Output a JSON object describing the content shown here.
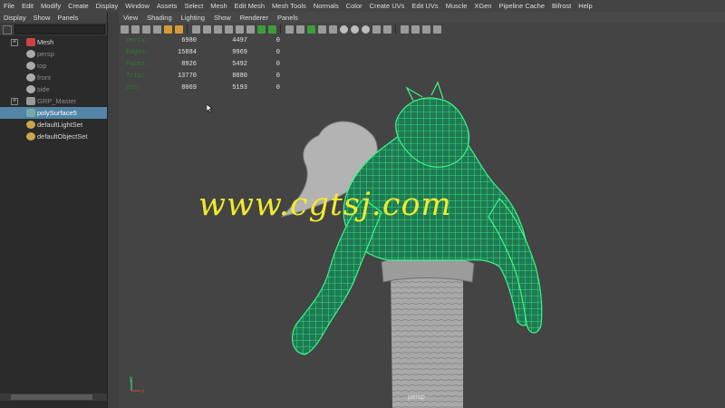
{
  "main_menu": [
    "File",
    "Edit",
    "Modify",
    "Create",
    "Display",
    "Window",
    "Assets",
    "Select",
    "Mesh",
    "Edit Mesh",
    "Mesh Tools",
    "Normals",
    "Color",
    "Create UVs",
    "Edit UVs",
    "Muscle",
    "XGen",
    "Pipeline Cache",
    "Bifrost",
    "Help"
  ],
  "outliner": {
    "menu": [
      "Display",
      "Show",
      "Panels"
    ],
    "items": [
      {
        "label": "Mesh",
        "icon": "mesh-icon",
        "expand": "+",
        "dim": false,
        "selected": false
      },
      {
        "label": "persp",
        "icon": "camera-icon",
        "dim": true,
        "selected": false
      },
      {
        "label": "top",
        "icon": "camera-icon",
        "dim": true,
        "selected": false
      },
      {
        "label": "front",
        "icon": "camera-icon",
        "dim": true,
        "selected": false
      },
      {
        "label": "side",
        "icon": "camera-icon",
        "dim": true,
        "selected": false
      },
      {
        "label": "GRP_Master",
        "icon": "group-icon",
        "expand": "+",
        "dim": true,
        "selected": false
      },
      {
        "label": "polySurface5",
        "icon": "poly-icon",
        "dim": false,
        "selected": true
      },
      {
        "label": "defaultLightSet",
        "icon": "set-icon",
        "dim": false,
        "selected": false
      },
      {
        "label": "defaultObjectSet",
        "icon": "set-icon",
        "dim": false,
        "selected": false
      }
    ]
  },
  "viewport": {
    "menu": [
      "View",
      "Shading",
      "Lighting",
      "Show",
      "Renderer",
      "Panels"
    ],
    "hud": [
      {
        "label": "Verts:",
        "v1": "6980",
        "v2": "4497",
        "v3": "0"
      },
      {
        "label": "Edges:",
        "v1": "15884",
        "v2": "9969",
        "v3": "0"
      },
      {
        "label": "Faces:",
        "v1": "8926",
        "v2": "5492",
        "v3": "0"
      },
      {
        "label": "Tris:",
        "v1": "13770",
        "v2": "8880",
        "v3": "0"
      },
      {
        "label": "UVs:",
        "v1": "8069",
        "v2": "5193",
        "v3": "0"
      }
    ],
    "camera_label": "persp",
    "axis_y": "y",
    "axis_x": "x"
  },
  "watermark": "www.cgtsj.com",
  "colors": {
    "wireframe": "#3cf58c",
    "selection": "#5285a6",
    "watermark": "#f0ea2e"
  }
}
